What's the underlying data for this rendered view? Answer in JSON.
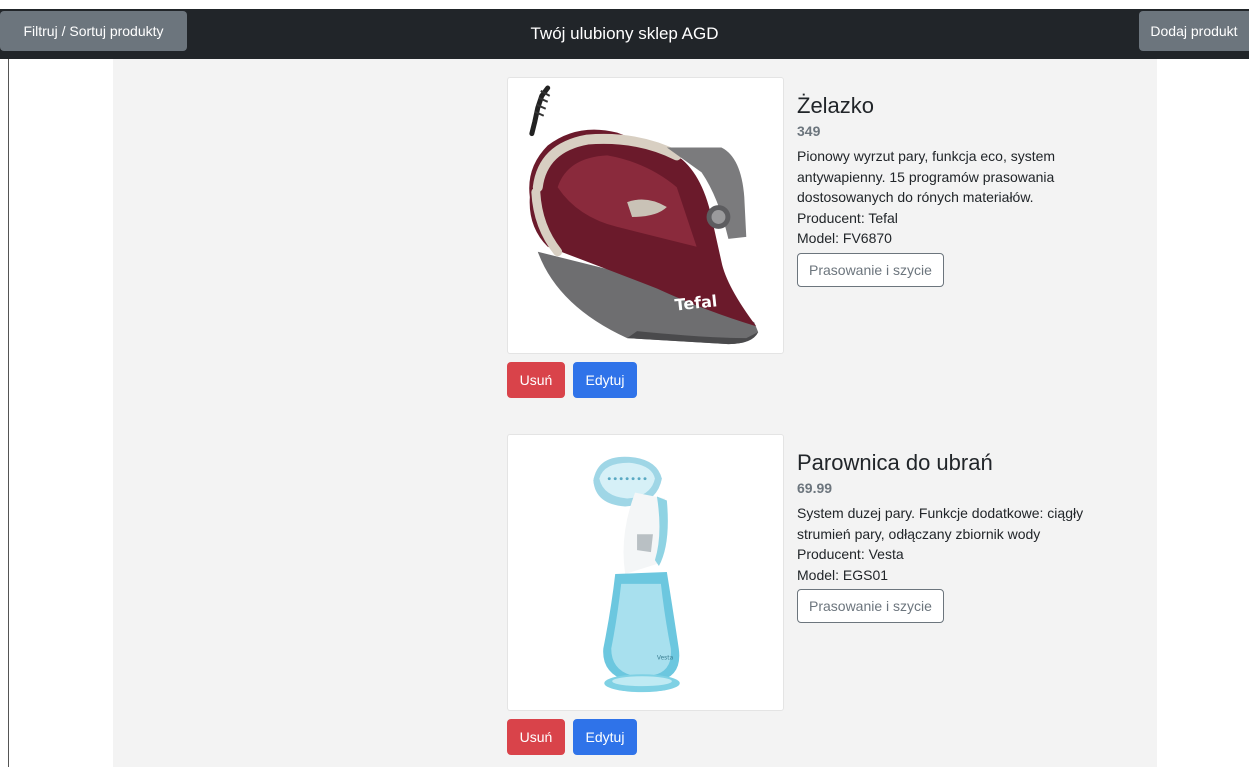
{
  "navbar": {
    "filter_button": "Filtruj / Sortuj produkty",
    "title": "Twój ulubiony sklep AGD",
    "add_button": "Dodaj produkt"
  },
  "products": [
    {
      "name": "Żelazko",
      "price": "349",
      "description": "Pionowy wyrzut pary, funkcja eco, system antywapienny. 15 programów prasowania dostosowanych do rónych materiałów.",
      "producer": "Producent: Tefal",
      "model": "Model: FV6870",
      "category": "Prasowanie i szycie",
      "image_icon": "iron-icon",
      "brand_mark": "Tefal",
      "delete_label": "Usuń",
      "edit_label": "Edytuj"
    },
    {
      "name": "Parownica do ubrań",
      "price": "69.99",
      "description": "System duzej pary. Funkcje dodatkowe: ciągły strumień pary, odłączany zbiornik wody",
      "producer": "Producent: Vesta",
      "model": "Model: EGS01",
      "category": "Prasowanie i szycie",
      "image_icon": "garment-steamer-icon",
      "brand_mark": "Vesta",
      "delete_label": "Usuń",
      "edit_label": "Edytuj"
    }
  ],
  "colors": {
    "navbar_bg": "#212529",
    "secondary": "#6c757d",
    "danger": "#d9434a",
    "primary": "#2f73e9",
    "container_bg": "#f3f3f3"
  }
}
